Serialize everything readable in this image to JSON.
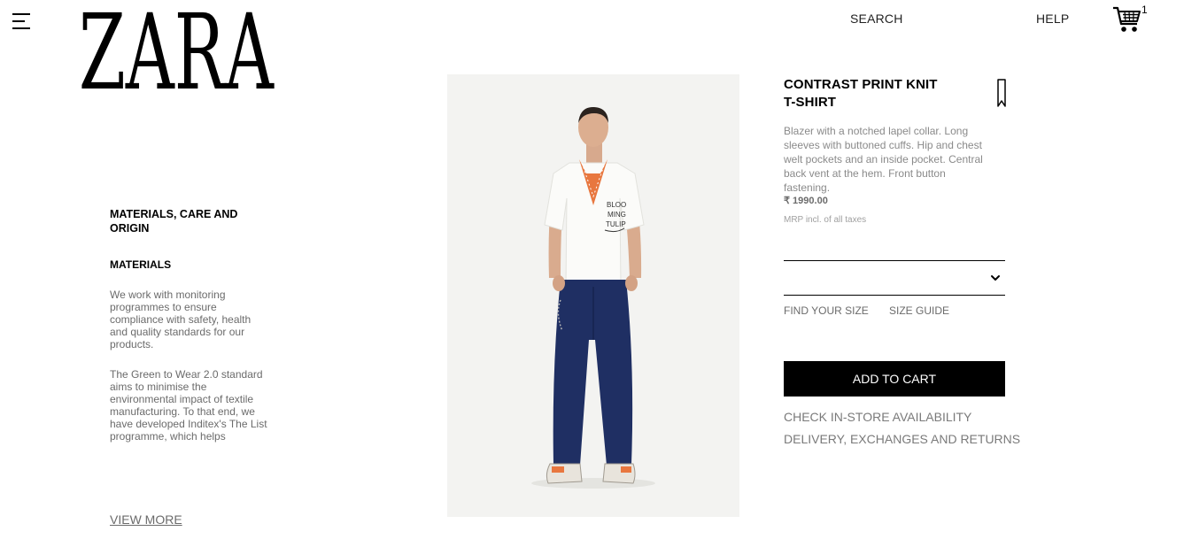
{
  "header": {
    "menu_icon": "hamburger-menu-icon",
    "logo_text": "ZARA",
    "search_label": "SEARCH",
    "help_label": "HELP",
    "cart_icon": "shopping-cart-icon",
    "cart_count": "1"
  },
  "materials": {
    "title": "MATERIALS, CARE AND ORIGIN",
    "subtitle": "MATERIALS",
    "paragraphs": [
      "We work with monitoring programmes to ensure compliance with safety, health and quality standards for our products.",
      "The Green to Wear 2.0 standard aims to minimise the environmental impact of textile manufacturing. To that end, we have developed Inditex's The List programme, which helps"
    ],
    "view_more_label": "VIEW MORE"
  },
  "product": {
    "title": "CONTRAST PRINT KNIT T-SHIRT",
    "description": "Blazer with a notched lapel collar. Long sleeves with buttoned cuffs. Hip and chest welt pockets and an inside pocket. Central back vent at the hem. Front button fastening.",
    "price": "₹ 1990.00",
    "tax_note": "MRP incl. of all taxes",
    "bookmark_icon": "bookmark-icon",
    "size_select_value": "",
    "find_size_label": "FIND YOUR SIZE",
    "size_guide_label": "SIZE GUIDE",
    "add_to_cart_label": "ADD TO CART",
    "check_store_label": "CHECK IN-STORE AVAILABILITY",
    "delivery_label": "DELIVERY, EXCHANGES AND RETURNS",
    "shirt_print_lines": [
      "BLOO",
      "MING",
      "TULIP"
    ]
  },
  "colors": {
    "background": "#ffffff",
    "text": "#000000",
    "muted_text": "#6b6b6b",
    "light_text": "#a0a0a0",
    "button_bg": "#000000",
    "button_text": "#ffffff",
    "image_bg": "#f2f2f0",
    "jeans": "#1f2f63",
    "bandana": "#e8773f"
  }
}
